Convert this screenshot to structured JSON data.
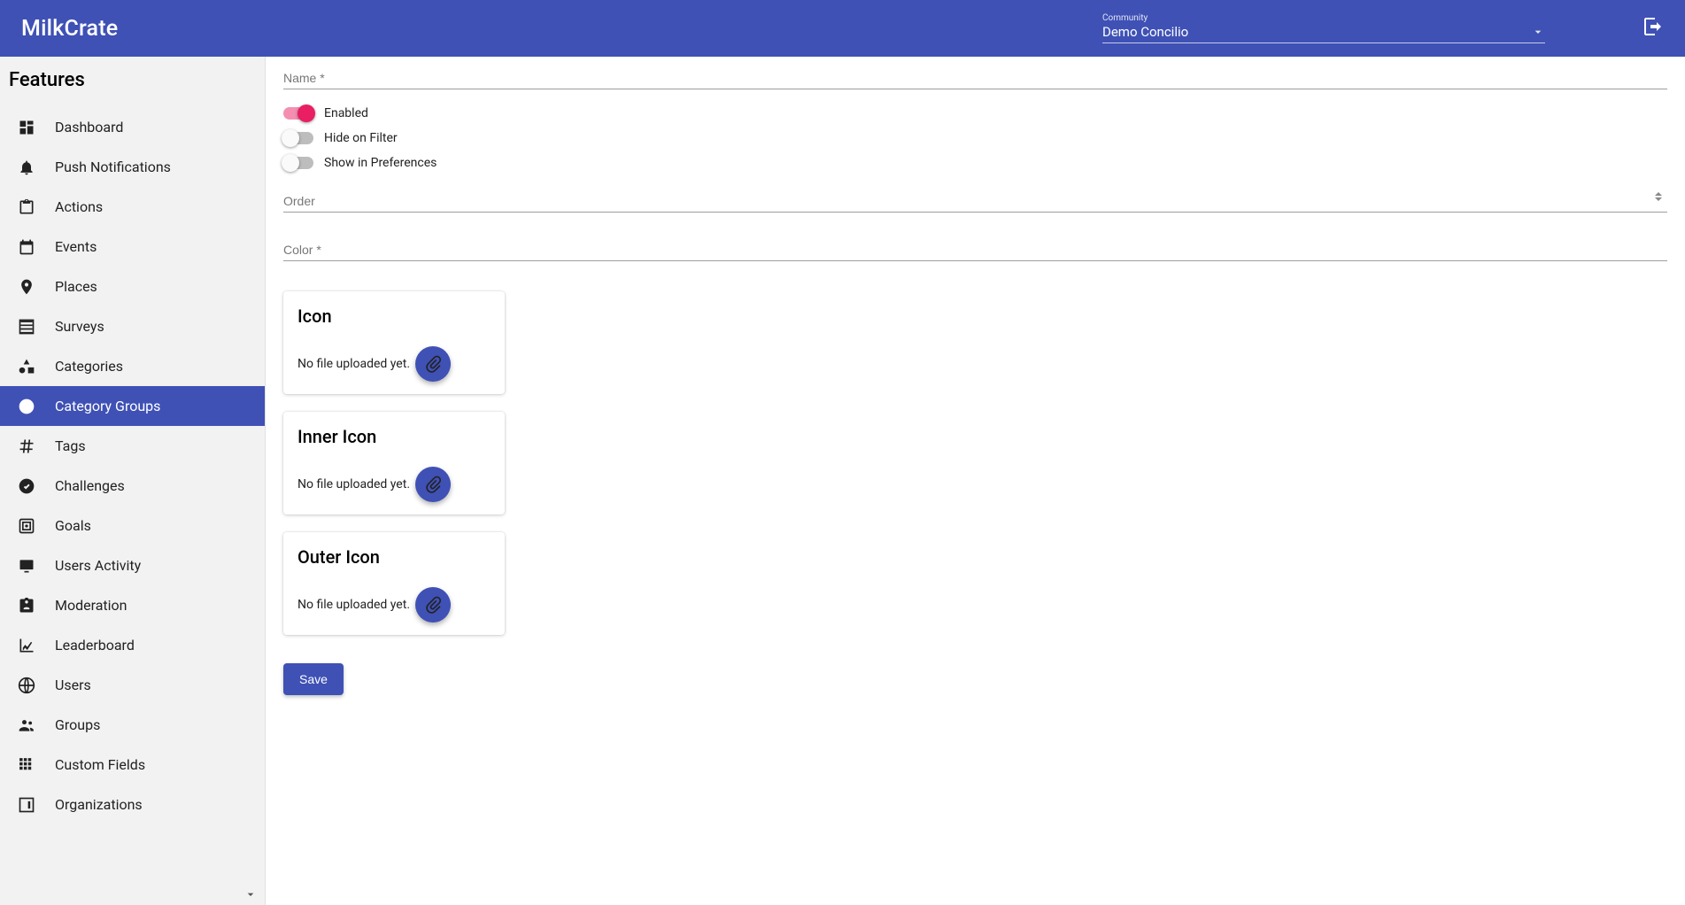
{
  "header": {
    "brand": "MilkCrate",
    "community_label": "Community",
    "community_value": "Demo Concilio"
  },
  "sidebar": {
    "title": "Features",
    "items": [
      {
        "label": "Dashboard",
        "icon": "dashboard"
      },
      {
        "label": "Push Notifications",
        "icon": "bell"
      },
      {
        "label": "Actions",
        "icon": "clipboard"
      },
      {
        "label": "Events",
        "icon": "calendar"
      },
      {
        "label": "Places",
        "icon": "pin"
      },
      {
        "label": "Surveys",
        "icon": "list"
      },
      {
        "label": "Categories",
        "icon": "shapes"
      },
      {
        "label": "Category Groups",
        "icon": "circle-dots",
        "active": true
      },
      {
        "label": "Tags",
        "icon": "hash"
      },
      {
        "label": "Challenges",
        "icon": "check-circle"
      },
      {
        "label": "Goals",
        "icon": "target-sq"
      },
      {
        "label": "Users Activity",
        "icon": "screen"
      },
      {
        "label": "Moderation",
        "icon": "badge"
      },
      {
        "label": "Leaderboard",
        "icon": "chart"
      },
      {
        "label": "Users",
        "icon": "globe"
      },
      {
        "label": "Groups",
        "icon": "people"
      },
      {
        "label": "Custom Fields",
        "icon": "grid"
      },
      {
        "label": "Organizations",
        "icon": "org"
      }
    ]
  },
  "form": {
    "name_label": "Name *",
    "name_value": "",
    "toggles": {
      "enabled": {
        "label": "Enabled",
        "on": true
      },
      "hide": {
        "label": "Hide on Filter",
        "on": false
      },
      "prefs": {
        "label": "Show in Preferences",
        "on": false
      }
    },
    "order_label": "Order",
    "order_value": "",
    "color_label": "Color *",
    "color_value": "",
    "uploads": [
      {
        "title": "Icon",
        "status": "No file uploaded yet."
      },
      {
        "title": "Inner Icon",
        "status": "No file uploaded yet."
      },
      {
        "title": "Outer Icon",
        "status": "No file uploaded yet."
      }
    ],
    "save_label": "Save"
  }
}
